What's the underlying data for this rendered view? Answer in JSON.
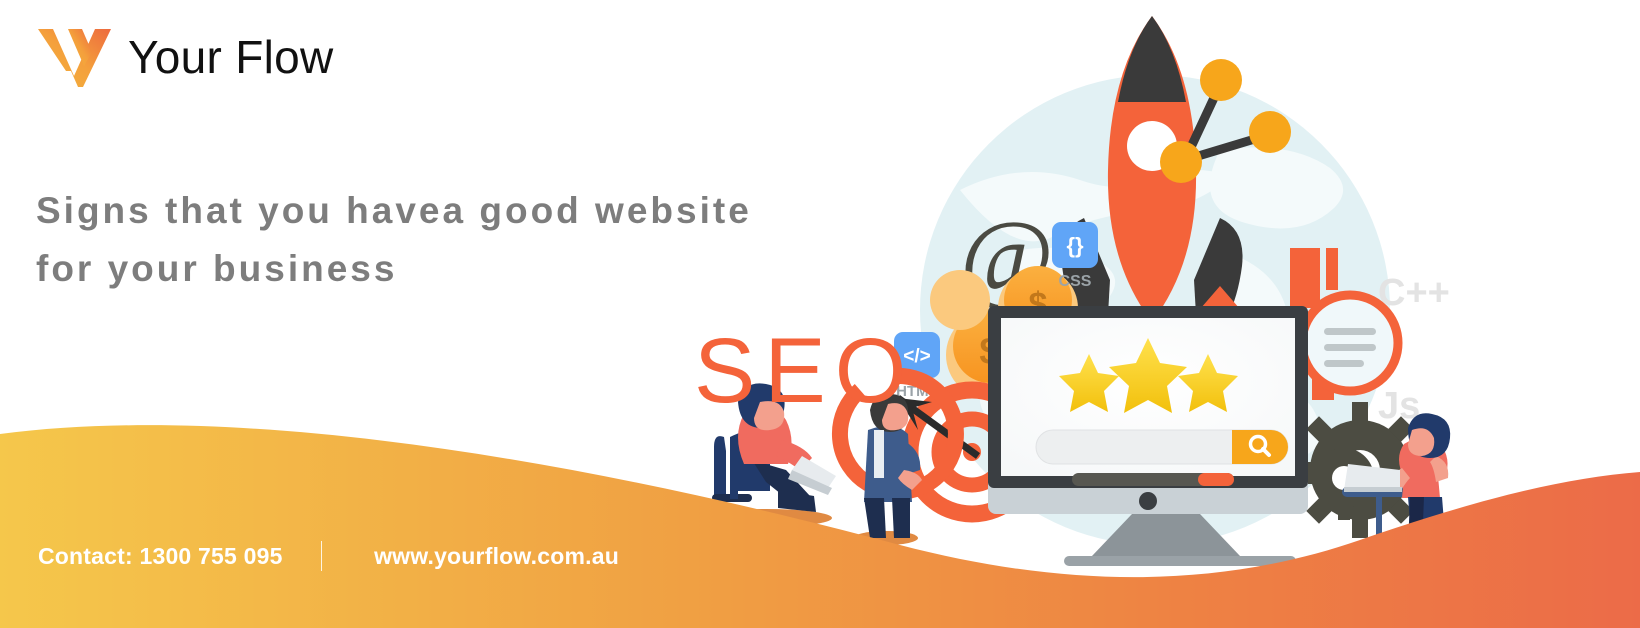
{
  "brand": {
    "name": "Your Flow",
    "logo_icon": "v-flow-logo-icon",
    "gradient_start": "#F5C544",
    "gradient_end": "#EE6A3E"
  },
  "headline": {
    "line1": "Signs that you havea good website",
    "line2": "for your business",
    "color": "#7d7d7d"
  },
  "footer": {
    "contact": "Contact: 1300 755 095",
    "separator": "|",
    "website": "www.yourflow.com.au",
    "text_color": "#ffffff"
  },
  "wave": {
    "gradient_left": "#F5C74B",
    "gradient_mid": "#F08236",
    "gradient_right": "#EC6B48"
  },
  "illustration": {
    "seo_text": "SEO",
    "seo_color": "#F4633A",
    "badges": [
      {
        "name": "css-badge",
        "glyph": "{}",
        "label": "CSS",
        "color": "#60A5F7"
      },
      {
        "name": "html-badge",
        "glyph": "</>",
        "label": "HTML",
        "color": "#60A5F7"
      }
    ],
    "code_labels": [
      {
        "name": "cpp-label",
        "text": "C++",
        "color": "#E3E3E3"
      },
      {
        "name": "js-label",
        "text": "Js",
        "color": "#E3E3E3"
      }
    ],
    "at_symbol": "@",
    "coin_symbol": "$",
    "monitor": {
      "search_value": "search",
      "search_placeholder": "search",
      "search_button_icon": "magnifier-icon",
      "search_button_color": "#F7A61B",
      "stars": 3,
      "star_color": "#F7D117",
      "progress_percent": 82
    },
    "accent_orange": "#F4633A",
    "accent_dark": "#3A3A3A",
    "sky_blue": "#DDEFF2"
  }
}
